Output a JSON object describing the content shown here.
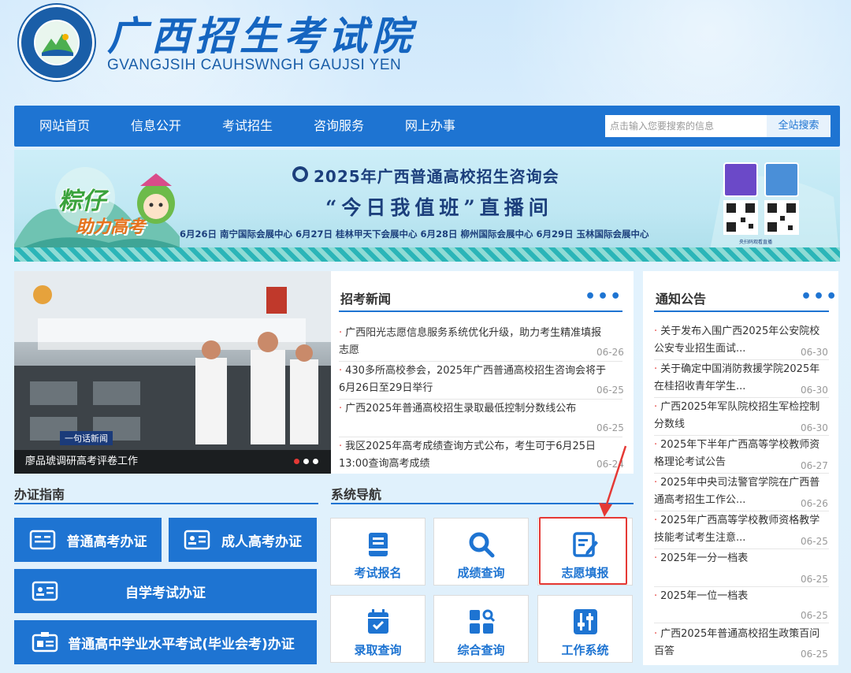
{
  "header": {
    "title": "广西招生考试院",
    "subtitle": "GVANGJSIH CAUHSWNGH GAUJSI YEN"
  },
  "nav": {
    "items": [
      "网站首页",
      "信息公开",
      "考试招生",
      "咨询服务",
      "网上办事"
    ],
    "search_placeholder": "点击输入您要搜索的信息",
    "search_button": "全站搜索"
  },
  "banner": {
    "slogan": "粽仔",
    "slogan2": "助力高考",
    "title": "2025年广西普通高校招生咨询会",
    "subtitle": "“今日我值班”直播间",
    "dates": "6月26日  南宁国际会展中心    6月27日  桂林甲天下会展中心    6月28日  柳州国际会展中心    6月29日  玉林国际会展中心",
    "qr_caption": "央扫码观看直播"
  },
  "photo": {
    "tag": "一句话新闻",
    "caption": "廖品琥调研高考评卷工作"
  },
  "news": {
    "title": "招考新闻",
    "items": [
      {
        "text": "广西阳光志愿信息服务系统优化升级，助力考生精准填报志愿",
        "date": "06-26"
      },
      {
        "text": "430多所高校参会，2025年广西普通高校招生咨询会将于6月26日至29日举行",
        "date": "06-25"
      },
      {
        "text": "广西2025年普通高校招生录取最低控制分数线公布",
        "date": "06-25"
      },
      {
        "text": "我区2025年高考成绩查询方式公布，考生可于6月25日13:00查询高考成绩",
        "date": "06-24"
      }
    ]
  },
  "notices": {
    "title": "通知公告",
    "items": [
      {
        "text": "关于发布入围广西2025年公安院校公安专业招生面试...",
        "date": "06-30"
      },
      {
        "text": "关于确定中国消防救援学院2025年在桂招收青年学生...",
        "date": "06-30"
      },
      {
        "text": "广西2025年军队院校招生军检控制分数线",
        "date": "06-30"
      },
      {
        "text": "2025年下半年广西高等学校教师资格理论考试公告",
        "date": "06-27"
      },
      {
        "text": "2025年中央司法警官学院在广西普通高考招生工作公...",
        "date": "06-26"
      },
      {
        "text": "2025年广西高等学校教师资格教学技能考试考生注意...",
        "date": "06-25"
      },
      {
        "text": "2025年一分一档表",
        "date": "06-25"
      },
      {
        "text": "2025年一位一档表",
        "date": "06-25"
      },
      {
        "text": "广西2025年普通高校招生政策百问百答",
        "date": "06-25"
      }
    ]
  },
  "guide": {
    "title": "办证指南",
    "buttons": [
      "普通高考办证",
      "成人高考办证",
      "自学考试办证",
      "普通高中学业水平考试(毕业会考)办证"
    ]
  },
  "system": {
    "title": "系统导航",
    "tiles": [
      "考试报名",
      "成绩查询",
      "志愿填报",
      "录取查询",
      "综合查询",
      "工作系统"
    ]
  },
  "colors": {
    "primary": "#1e74d2",
    "highlight": "#e53935",
    "background": "#d7ecfa"
  }
}
